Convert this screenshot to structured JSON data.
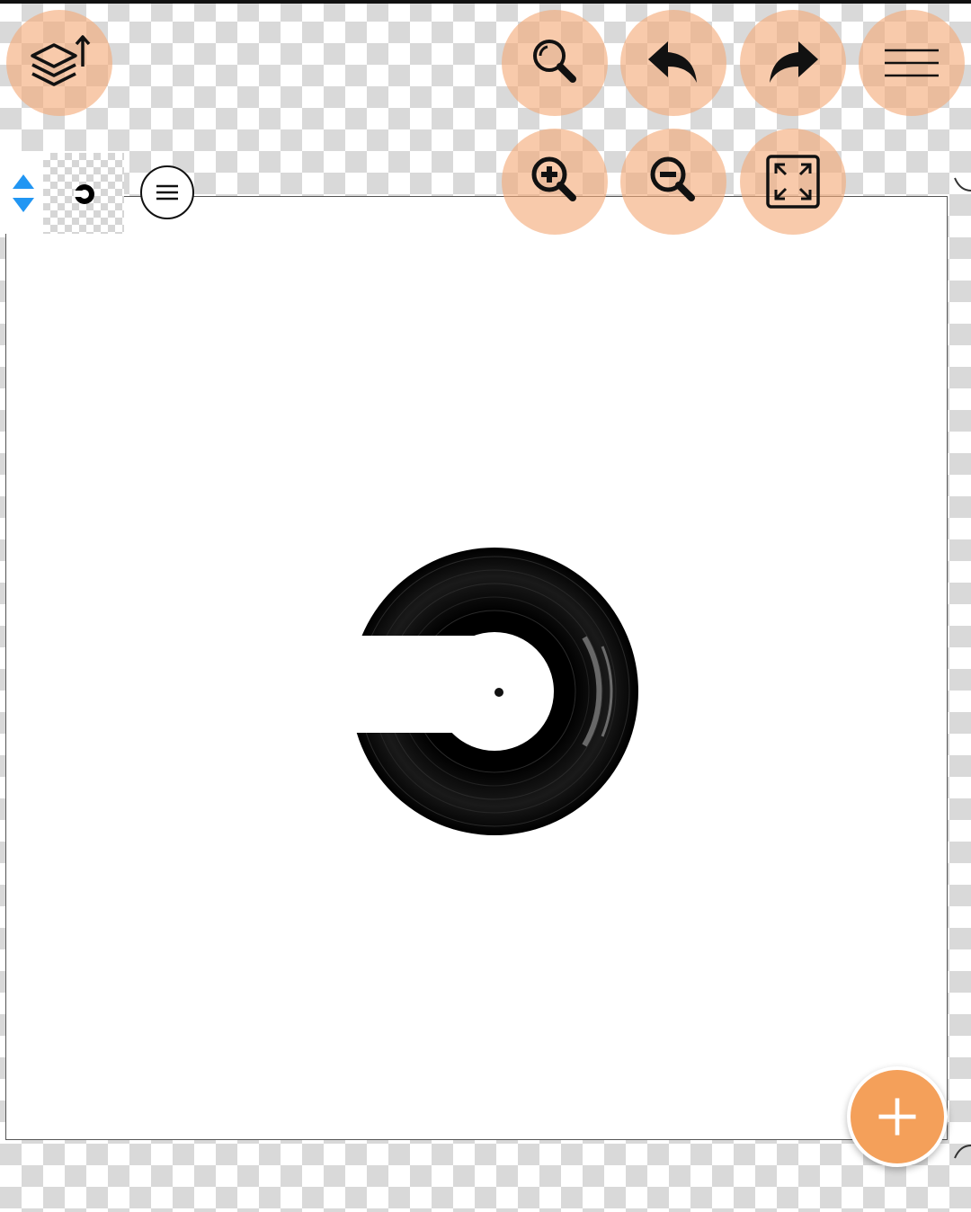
{
  "toolbar": {
    "layers_button": {
      "icon": "layers-icon"
    },
    "search_button": {
      "icon": "search-icon"
    },
    "undo_button": {
      "icon": "undo-icon"
    },
    "redo_button": {
      "icon": "redo-icon"
    },
    "menu_button": {
      "icon": "hamburger-icon"
    },
    "zoom_in_button": {
      "icon": "zoom-in-icon"
    },
    "zoom_out_button": {
      "icon": "zoom-out-icon"
    },
    "fit_button": {
      "icon": "fit-screen-icon"
    }
  },
  "layer_panel": {
    "reorder_icon": "reorder-arrows-icon",
    "thumbnail_icon": "vinyl-record-thumbnail",
    "menu_icon": "layer-menu-icon"
  },
  "add_button": {
    "icon": "plus-icon"
  },
  "colors": {
    "tool_circle": "#f4aa78",
    "accent": "#f4a05a",
    "reorder_arrows": "#2196f3",
    "checker": "#d9d9d9"
  }
}
